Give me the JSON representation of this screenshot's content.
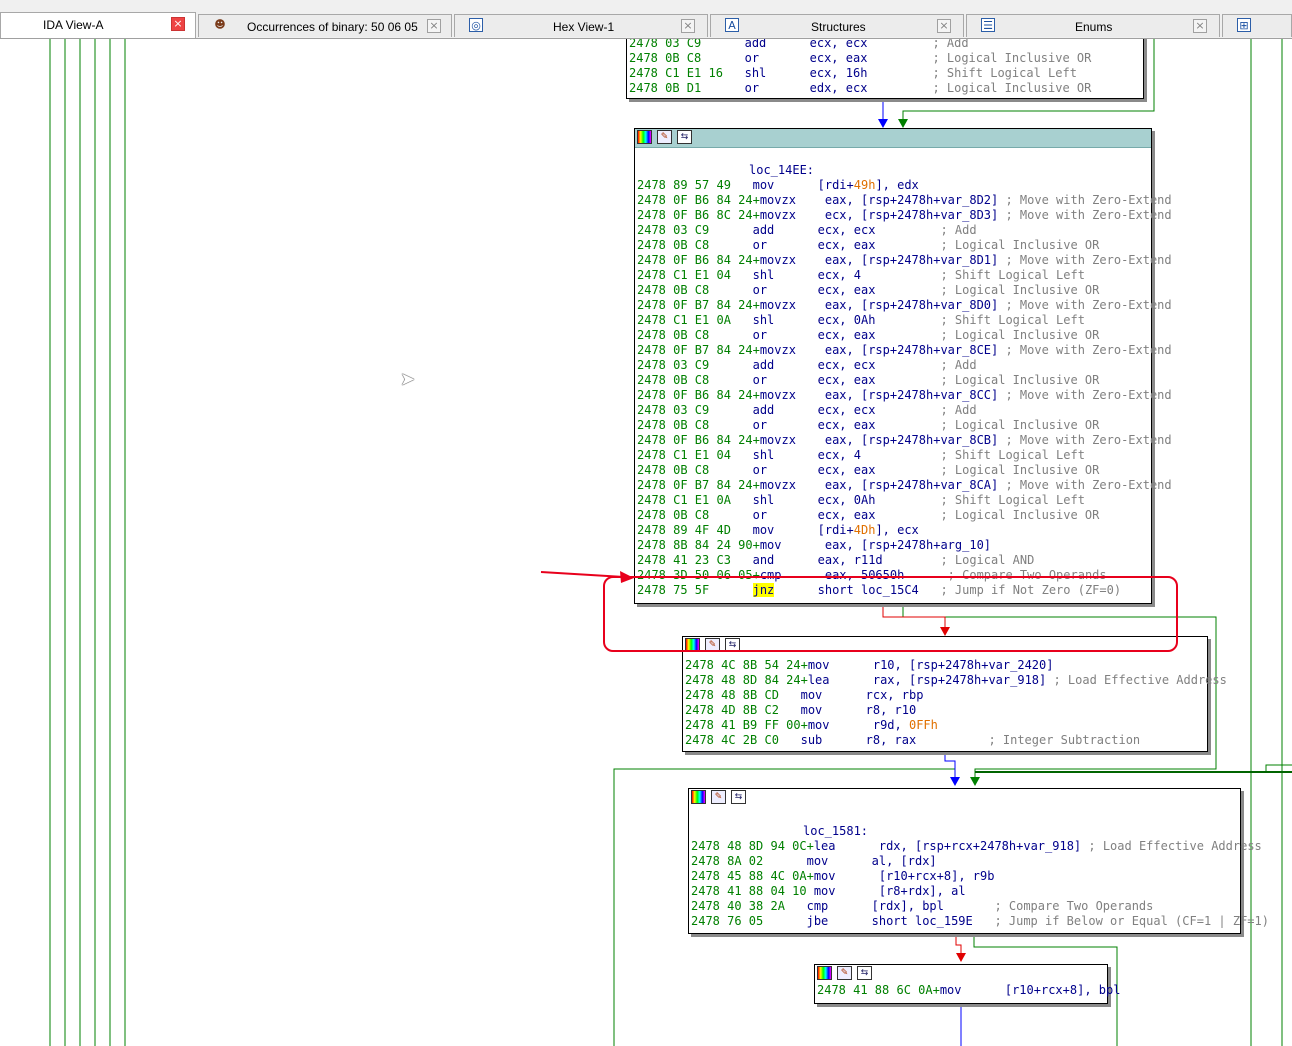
{
  "tabs": [
    {
      "label": "IDA View-A",
      "icon": "none",
      "active": true
    },
    {
      "label": "Occurrences of binary: 50 06 05",
      "icon": "person-icon"
    },
    {
      "label": "Hex View-1",
      "icon": "hex-icon"
    },
    {
      "label": "Structures",
      "icon": "structures-icon"
    },
    {
      "label": "Enums",
      "icon": "enums-icon"
    }
  ],
  "colors": {
    "address": "#008000",
    "code": "#00008b",
    "comment": "#808080",
    "number": "#e07000",
    "highlight": "#ffff00",
    "annotation": "#e8001c",
    "edge_true": "#008000",
    "edge_false": "#e00000",
    "edge_uncond": "#0000ff"
  },
  "block_top": {
    "lines": [
      {
        "a": "2478 03 C9      ",
        "c": "add      ecx, ecx         ",
        "m": "; Add"
      },
      {
        "a": "2478 0B C8      ",
        "c": "or       ecx, eax         ",
        "m": "; Logical Inclusive OR"
      },
      {
        "a": "2478 C1 E1 16   ",
        "c": "shl      ecx, 16h         ",
        "m": "; Shift Logical Left"
      },
      {
        "a": "2478 0B D1      ",
        "c": "or       edx, ecx         ",
        "m": "; Logical Inclusive OR"
      }
    ]
  },
  "block_14EE": {
    "label": "loc_14EE:",
    "lines": [
      {
        "a": "2478 89 57 49   ",
        "c": "mov      [rdi+49h], edx",
        "m": ""
      },
      {
        "a": "2478 0F B6 84 24+",
        "c": "movzx    eax, [rsp+2478h+var_8D2] ",
        "m": "; Move with Zero-Extend"
      },
      {
        "a": "2478 0F B6 8C 24+",
        "c": "movzx    ecx, [rsp+2478h+var_8D3] ",
        "m": "; Move with Zero-Extend"
      },
      {
        "a": "2478 03 C9      ",
        "c": "add      ecx, ecx         ",
        "m": "; Add"
      },
      {
        "a": "2478 0B C8      ",
        "c": "or       ecx, eax         ",
        "m": "; Logical Inclusive OR"
      },
      {
        "a": "2478 0F B6 84 24+",
        "c": "movzx    eax, [rsp+2478h+var_8D1] ",
        "m": "; Move with Zero-Extend"
      },
      {
        "a": "2478 C1 E1 04   ",
        "c": "shl      ecx, 4           ",
        "m": "; Shift Logical Left"
      },
      {
        "a": "2478 0B C8      ",
        "c": "or       ecx, eax         ",
        "m": "; Logical Inclusive OR"
      },
      {
        "a": "2478 0F B7 84 24+",
        "c": "movzx    eax, [rsp+2478h+var_8D0] ",
        "m": "; Move with Zero-Extend"
      },
      {
        "a": "2478 C1 E1 0A   ",
        "c": "shl      ecx, 0Ah         ",
        "m": "; Shift Logical Left"
      },
      {
        "a": "2478 0B C8      ",
        "c": "or       ecx, eax         ",
        "m": "; Logical Inclusive OR"
      },
      {
        "a": "2478 0F B7 84 24+",
        "c": "movzx    eax, [rsp+2478h+var_8CE] ",
        "m": "; Move with Zero-Extend"
      },
      {
        "a": "2478 03 C9      ",
        "c": "add      ecx, ecx         ",
        "m": "; Add"
      },
      {
        "a": "2478 0B C8      ",
        "c": "or       ecx, eax         ",
        "m": "; Logical Inclusive OR"
      },
      {
        "a": "2478 0F B6 84 24+",
        "c": "movzx    eax, [rsp+2478h+var_8CC] ",
        "m": "; Move with Zero-Extend"
      },
      {
        "a": "2478 03 C9      ",
        "c": "add      ecx, ecx         ",
        "m": "; Add"
      },
      {
        "a": "2478 0B C8      ",
        "c": "or       ecx, eax         ",
        "m": "; Logical Inclusive OR"
      },
      {
        "a": "2478 0F B6 84 24+",
        "c": "movzx    eax, [rsp+2478h+var_8CB] ",
        "m": "; Move with Zero-Extend"
      },
      {
        "a": "2478 C1 E1 04   ",
        "c": "shl      ecx, 4           ",
        "m": "; Shift Logical Left"
      },
      {
        "a": "2478 0B C8      ",
        "c": "or       ecx, eax         ",
        "m": "; Logical Inclusive OR"
      },
      {
        "a": "2478 0F B7 84 24+",
        "c": "movzx    eax, [rsp+2478h+var_8CA] ",
        "m": "; Move with Zero-Extend"
      },
      {
        "a": "2478 C1 E1 0A   ",
        "c": "shl      ecx, 0Ah         ",
        "m": "; Shift Logical Left"
      },
      {
        "a": "2478 0B C8      ",
        "c": "or       ecx, eax         ",
        "m": "; Logical Inclusive OR"
      },
      {
        "a": "2478 89 4F 4D   ",
        "c": "mov      [rdi+4Dh], ecx",
        "m": ""
      },
      {
        "a": "2478 8B 84 24 90+",
        "c": "mov      eax, [rsp+2478h+arg_10]",
        "m": ""
      },
      {
        "a": "2478 41 23 C3   ",
        "c": "and      eax, r11d        ",
        "m": "; Logical AND"
      },
      {
        "a": "2478 3D 50 06 05+",
        "c": "cmp      eax, 50650h      ",
        "m": "; Compare Two Operands"
      },
      {
        "a": "2478 75 5F      ",
        "c": "jnz      short loc_15C4   ",
        "m": "; Jump if Not Zero (ZF=0)"
      }
    ]
  },
  "block_mid": {
    "lines": [
      {
        "a": "2478 4C 8B 54 24+",
        "c": "mov      r10, [rsp+2478h+var_2420]",
        "m": ""
      },
      {
        "a": "2478 48 8D 84 24+",
        "c": "lea      rax, [rsp+2478h+var_918] ",
        "m": "; Load Effective Address"
      },
      {
        "a": "2478 48 8B CD   ",
        "c": "mov      rcx, rbp",
        "m": ""
      },
      {
        "a": "2478 4D 8B C2   ",
        "c": "mov      r8, r10",
        "m": ""
      },
      {
        "a": "2478 41 B9 FF 00+",
        "c": "mov      r9d, 0FFh",
        "m": ""
      },
      {
        "a": "2478 4C 2B C0   ",
        "c": "sub      r8, rax          ",
        "m": "; Integer Subtraction"
      }
    ]
  },
  "block_1581": {
    "label": "loc_1581:",
    "lines": [
      {
        "a": "2478 48 8D 94 0C+",
        "c": "lea      rdx, [rsp+rcx+2478h+var_918] ",
        "m": "; Load Effective Address"
      },
      {
        "a": "2478 8A 02      ",
        "c": "mov      al, [rdx]",
        "m": ""
      },
      {
        "a": "2478 45 88 4C 0A+",
        "c": "mov      [r10+rcx+8], r9b",
        "m": ""
      },
      {
        "a": "2478 41 88 04 10 ",
        "c": "mov      [r8+rdx], al",
        "m": ""
      },
      {
        "a": "2478 40 38 2A   ",
        "c": "cmp      [rdx], bpl       ",
        "m": "; Compare Two Operands"
      },
      {
        "a": "2478 76 05      ",
        "c": "jbe      short loc_159E   ",
        "m": "; Jump if Below or Equal (CF=1 | ZF=1)"
      }
    ]
  },
  "block_bottom": {
    "lines": [
      {
        "a": "2478 41 88 6C 0A+",
        "c": "mov      [r10+rcx+8], bpl",
        "m": ""
      }
    ]
  }
}
